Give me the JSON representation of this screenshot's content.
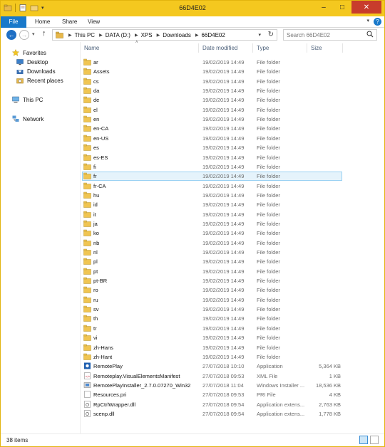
{
  "window": {
    "title": "66D4E02"
  },
  "ribbon": {
    "file_label": "File",
    "home_label": "Home",
    "share_label": "Share",
    "view_label": "View",
    "help_label": "?"
  },
  "address": {
    "crumbs": [
      "This PC",
      "DATA (D:)",
      "XPS",
      "Downloads",
      "66D4E02"
    ],
    "search_placeholder": "Search 66D4E02"
  },
  "navpane": {
    "favorites": "Favorites",
    "desktop": "Desktop",
    "downloads": "Downloads",
    "recent": "Recent places",
    "thispc": "This PC",
    "network": "Network"
  },
  "columns": {
    "name": "Name",
    "date": "Date modified",
    "type": "Type",
    "size": "Size"
  },
  "files": [
    {
      "name": "ar",
      "date": "19/02/2019 14:49",
      "type": "File folder",
      "size": "",
      "icon": "folder"
    },
    {
      "name": "Assets",
      "date": "19/02/2019 14:49",
      "type": "File folder",
      "size": "",
      "icon": "folder"
    },
    {
      "name": "cs",
      "date": "19/02/2019 14:49",
      "type": "File folder",
      "size": "",
      "icon": "folder"
    },
    {
      "name": "da",
      "date": "19/02/2019 14:49",
      "type": "File folder",
      "size": "",
      "icon": "folder"
    },
    {
      "name": "de",
      "date": "19/02/2019 14:49",
      "type": "File folder",
      "size": "",
      "icon": "folder"
    },
    {
      "name": "el",
      "date": "19/02/2019 14:49",
      "type": "File folder",
      "size": "",
      "icon": "folder"
    },
    {
      "name": "en",
      "date": "19/02/2019 14:49",
      "type": "File folder",
      "size": "",
      "icon": "folder"
    },
    {
      "name": "en-CA",
      "date": "19/02/2019 14:49",
      "type": "File folder",
      "size": "",
      "icon": "folder"
    },
    {
      "name": "en-US",
      "date": "19/02/2019 14:49",
      "type": "File folder",
      "size": "",
      "icon": "folder"
    },
    {
      "name": "es",
      "date": "19/02/2019 14:49",
      "type": "File folder",
      "size": "",
      "icon": "folder"
    },
    {
      "name": "es-ES",
      "date": "19/02/2019 14:49",
      "type": "File folder",
      "size": "",
      "icon": "folder"
    },
    {
      "name": "fi",
      "date": "19/02/2019 14:49",
      "type": "File folder",
      "size": "",
      "icon": "folder"
    },
    {
      "name": "fr",
      "date": "19/02/2019 14:49",
      "type": "File folder",
      "size": "",
      "icon": "folder",
      "selected": true
    },
    {
      "name": "fr-CA",
      "date": "19/02/2019 14:49",
      "type": "File folder",
      "size": "",
      "icon": "folder"
    },
    {
      "name": "hu",
      "date": "19/02/2019 14:49",
      "type": "File folder",
      "size": "",
      "icon": "folder"
    },
    {
      "name": "id",
      "date": "19/02/2019 14:49",
      "type": "File folder",
      "size": "",
      "icon": "folder"
    },
    {
      "name": "it",
      "date": "19/02/2019 14:49",
      "type": "File folder",
      "size": "",
      "icon": "folder"
    },
    {
      "name": "ja",
      "date": "19/02/2019 14:49",
      "type": "File folder",
      "size": "",
      "icon": "folder"
    },
    {
      "name": "ko",
      "date": "19/02/2019 14:49",
      "type": "File folder",
      "size": "",
      "icon": "folder"
    },
    {
      "name": "nb",
      "date": "19/02/2019 14:49",
      "type": "File folder",
      "size": "",
      "icon": "folder"
    },
    {
      "name": "nl",
      "date": "19/02/2019 14:49",
      "type": "File folder",
      "size": "",
      "icon": "folder"
    },
    {
      "name": "pl",
      "date": "19/02/2019 14:49",
      "type": "File folder",
      "size": "",
      "icon": "folder"
    },
    {
      "name": "pt",
      "date": "19/02/2019 14:49",
      "type": "File folder",
      "size": "",
      "icon": "folder"
    },
    {
      "name": "pt-BR",
      "date": "19/02/2019 14:49",
      "type": "File folder",
      "size": "",
      "icon": "folder"
    },
    {
      "name": "ro",
      "date": "19/02/2019 14:49",
      "type": "File folder",
      "size": "",
      "icon": "folder"
    },
    {
      "name": "ru",
      "date": "19/02/2019 14:49",
      "type": "File folder",
      "size": "",
      "icon": "folder"
    },
    {
      "name": "sv",
      "date": "19/02/2019 14:49",
      "type": "File folder",
      "size": "",
      "icon": "folder"
    },
    {
      "name": "th",
      "date": "19/02/2019 14:49",
      "type": "File folder",
      "size": "",
      "icon": "folder"
    },
    {
      "name": "tr",
      "date": "19/02/2019 14:49",
      "type": "File folder",
      "size": "",
      "icon": "folder"
    },
    {
      "name": "vi",
      "date": "19/02/2019 14:49",
      "type": "File folder",
      "size": "",
      "icon": "folder"
    },
    {
      "name": "zh-Hans",
      "date": "19/02/2019 14:49",
      "type": "File folder",
      "size": "",
      "icon": "folder"
    },
    {
      "name": "zh-Hant",
      "date": "19/02/2019 14:49",
      "type": "File folder",
      "size": "",
      "icon": "folder"
    },
    {
      "name": "RemotePlay",
      "date": "27/07/2018 10:10",
      "type": "Application",
      "size": "5,364 KB",
      "icon": "app"
    },
    {
      "name": "Remoteplay.VisualElementsManifest",
      "date": "27/07/2018 09:53",
      "type": "XML File",
      "size": "1 KB",
      "icon": "xml"
    },
    {
      "name": "RemotePlayInstaller_2.7.0.07270_Win32",
      "date": "27/07/2018 11:04",
      "type": "Windows Installer ...",
      "size": "18,536 KB",
      "icon": "installer"
    },
    {
      "name": "Resources.pri",
      "date": "27/07/2018 09:53",
      "type": "PRI File",
      "size": "4 KB",
      "icon": "file"
    },
    {
      "name": "RpCtrlWrapper.dll",
      "date": "27/07/2018 09:54",
      "type": "Application extens...",
      "size": "2,763 KB",
      "icon": "dll"
    },
    {
      "name": "scenp.dll",
      "date": "27/07/2018 09:54",
      "type": "Application extens...",
      "size": "1,778 KB",
      "icon": "dll"
    }
  ],
  "status": {
    "item_count": "38 items"
  }
}
